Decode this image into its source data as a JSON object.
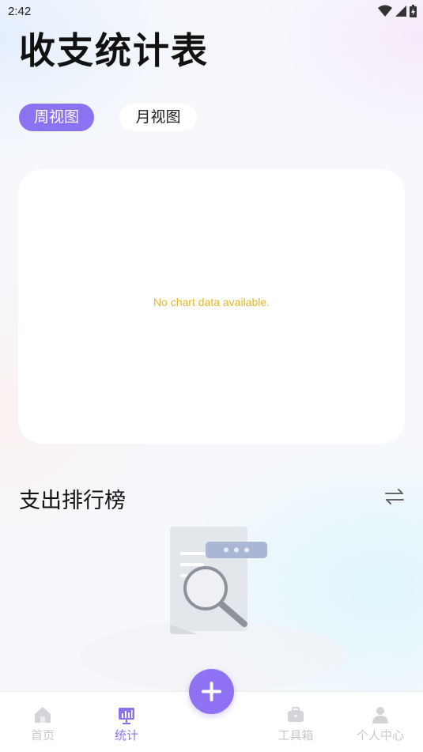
{
  "status_bar": {
    "time": "2:42"
  },
  "page": {
    "title": "收支统计表"
  },
  "tabs": [
    {
      "label": "周视图",
      "active": true
    },
    {
      "label": "月视图",
      "active": false
    }
  ],
  "chart_card": {
    "empty_message": "No chart data available."
  },
  "ranking": {
    "title": "支出排行榜",
    "swap_icon": "swap-arrows-icon"
  },
  "bottom_nav": {
    "items": [
      {
        "label": "首页",
        "icon": "home-icon",
        "active": false
      },
      {
        "label": "统计",
        "icon": "stats-icon",
        "active": true
      },
      {
        "label": "工具箱",
        "icon": "toolbox-icon",
        "active": false
      },
      {
        "label": "个人中心",
        "icon": "profile-icon",
        "active": false
      }
    ],
    "fab_icon": "plus-icon"
  },
  "colors": {
    "accent": "#8a72f0",
    "empty_text": "#e2b62a",
    "nav_inactive": "#c8c8cc"
  }
}
